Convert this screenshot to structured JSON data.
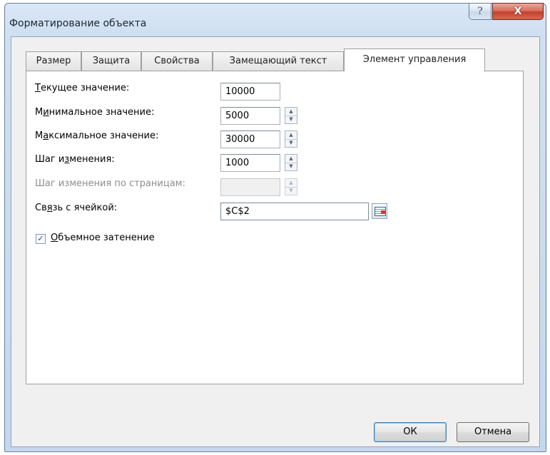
{
  "window": {
    "title": "Форматирование объекта",
    "help_label": "?",
    "close_label": "X"
  },
  "tabs": [
    {
      "label": "Размер"
    },
    {
      "label": "Защита"
    },
    {
      "label": "Свойства"
    },
    {
      "label": "Замещающий текст"
    },
    {
      "label": "Элемент управления",
      "active": true
    }
  ],
  "fields": {
    "current": {
      "label_pre": "",
      "label_u": "Т",
      "label_post": "екущее значение:",
      "value": "10000"
    },
    "min": {
      "label_pre": "М",
      "label_u": "и",
      "label_post": "нимальное значение:",
      "value": "5000"
    },
    "max": {
      "label_pre": "М",
      "label_u": "а",
      "label_post": "ксимальное значение:",
      "value": "30000"
    },
    "step": {
      "label_pre": "Шаг и",
      "label_u": "з",
      "label_post": "менения:",
      "value": "1000"
    },
    "page_step": {
      "label": "Шаг изменения по страницам:",
      "value": ""
    },
    "cell_link": {
      "label_pre": "Св",
      "label_u": "я",
      "label_post": "зь с ячейкой:",
      "value": "$C$2"
    }
  },
  "shading": {
    "label_u": "О",
    "label_post": "бъемное затенение",
    "checked": true,
    "check_glyph": "✓"
  },
  "buttons": {
    "ok": "ОК",
    "cancel": "Отмена"
  },
  "spinner_glyphs": {
    "up": "▲",
    "down": "▼"
  }
}
